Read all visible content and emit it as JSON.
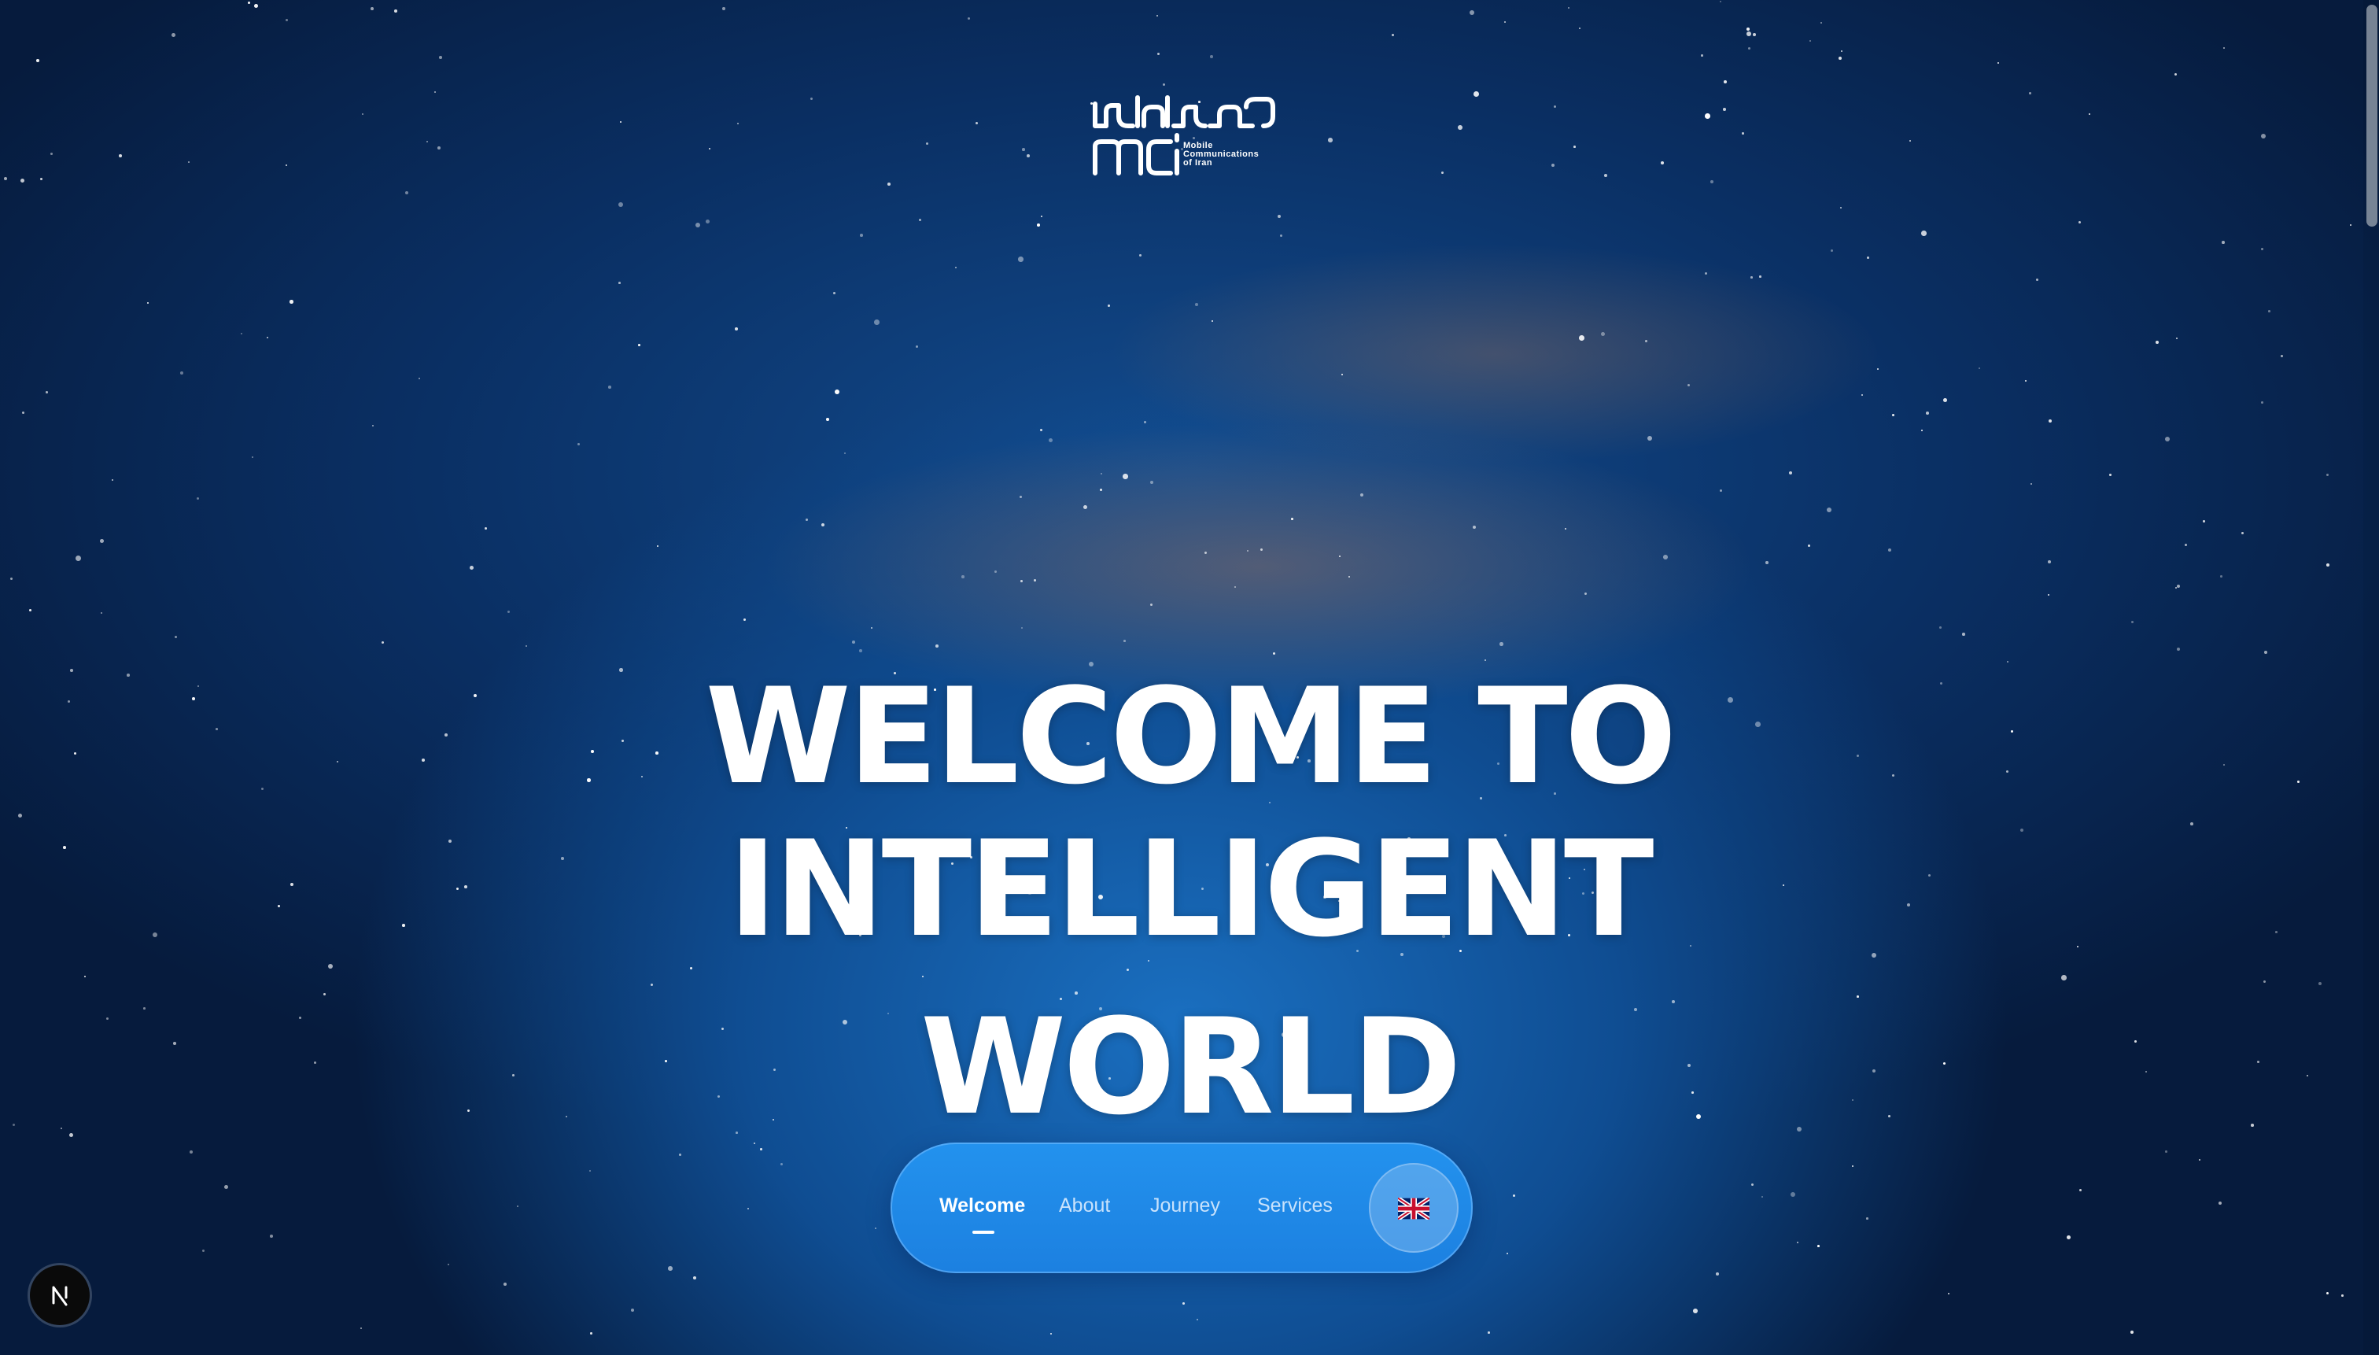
{
  "logo": {
    "persian_text": "همراه اول",
    "mark_text": "mci",
    "sub_lines": [
      "Mobile",
      "Communications",
      "of Iran"
    ]
  },
  "hero": {
    "line1": "WELCOME TO",
    "line2": "INTELLIGENT",
    "line3": "WORLD"
  },
  "nav": {
    "items": [
      {
        "label": "Welcome",
        "active": true
      },
      {
        "label": "About",
        "active": false
      },
      {
        "label": "Journey",
        "active": false
      },
      {
        "label": "Services",
        "active": false
      }
    ],
    "language_icon": "uk-flag-icon"
  },
  "badge": {
    "letter": "N",
    "icon": "nextjs-icon"
  },
  "colors": {
    "nav_background": "#1f88e6",
    "text": "#ffffff",
    "sky_dark": "#061b3d",
    "sky_mid": "#124c8f"
  }
}
